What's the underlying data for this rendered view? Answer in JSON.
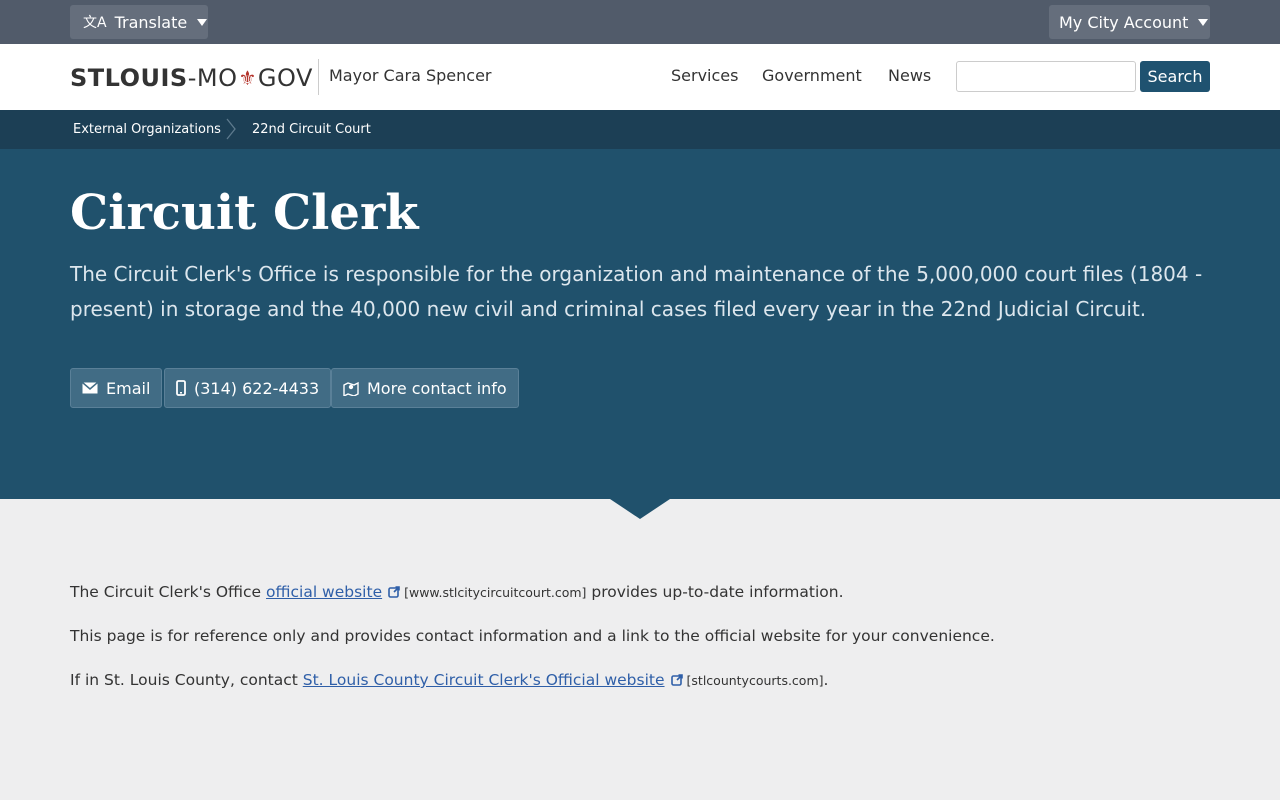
{
  "topbar": {
    "translate_label": "Translate",
    "account_label": "My City Account"
  },
  "header": {
    "logo_bold": "STLOUIS",
    "logo_middle": "-MO",
    "logo_end": "GOV",
    "mayor": "Mayor Cara Spencer",
    "nav": [
      "Services",
      "Government",
      "News"
    ],
    "search_placeholder": "",
    "search_label": "Search"
  },
  "breadcrumb": [
    "External Organizations",
    "22nd Circuit Court"
  ],
  "hero": {
    "title": "Circuit Clerk",
    "description": "The Circuit Clerk's Office is responsible for the organization and maintenance of the 5,000,000 court files (1804 - present) in storage and the 40,000 new civil and criminal cases filed every year in the 22nd Judicial Circuit.",
    "buttons": {
      "email": "Email",
      "phone": "(314) 622-4433",
      "contact": "More contact info"
    }
  },
  "content": {
    "p1_before": "The Circuit Clerk's Office ",
    "p1_link": "official website",
    "p1_url": "[www.stlcitycircuitcourt.com]",
    "p1_after": " provides up-to-date information.",
    "p2": "This page is for reference only and provides contact information and a link to the official website for your convenience.",
    "p3_before": "If in St. Louis County, contact ",
    "p3_link": "St. Louis County Circuit Clerk's Official website",
    "p3_url": "[stlcountycourts.com]",
    "p3_after": "."
  },
  "colors": {
    "topbar": "#515b6a",
    "hero": "#20516c",
    "breadcrumb": "#1c3f55",
    "accent_red": "#b4342c",
    "link": "#2f5fa8"
  }
}
